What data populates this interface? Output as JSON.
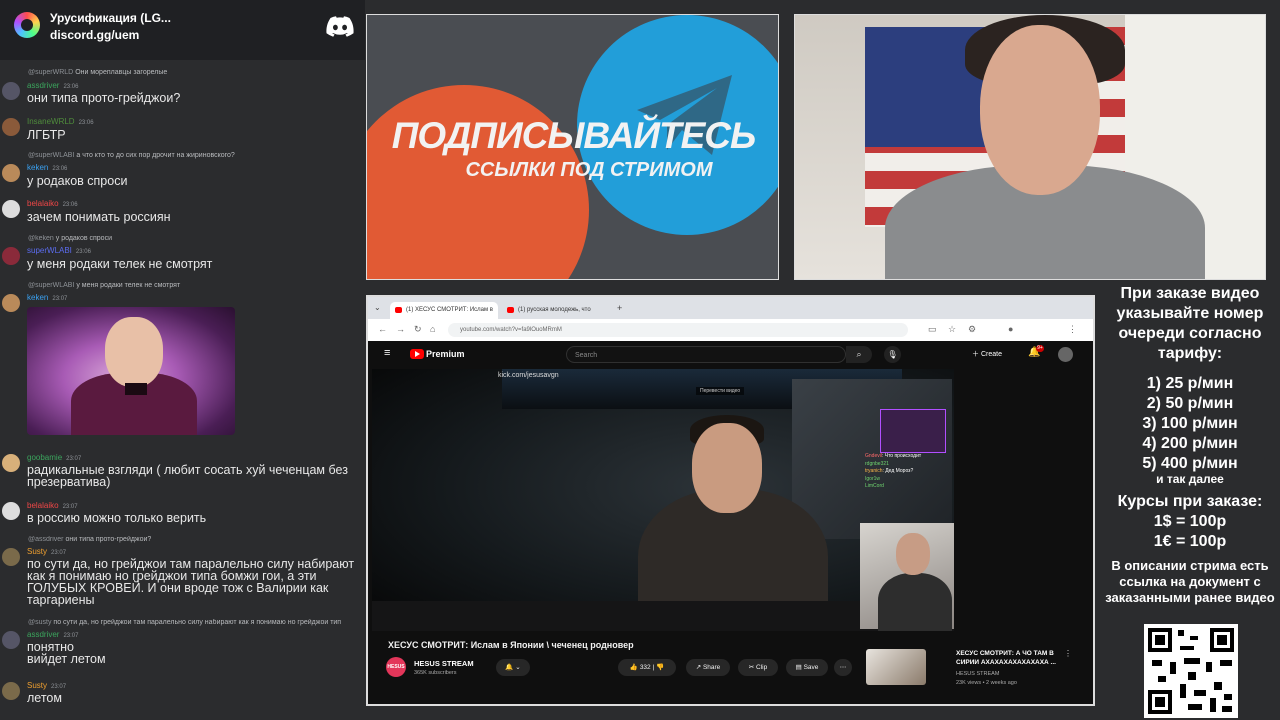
{
  "discord": {
    "server_name": "Урусификация (LG...",
    "invite": "discord.gg/uem"
  },
  "chat": [
    {
      "reply_to": "@superWRLD",
      "reply_text": "Они мореплавцы загорелые",
      "user": "assdriver",
      "time": "23:06",
      "text": "они типа прото-грейджои?",
      "color": "#3ba55d"
    },
    {
      "user": "InsaneWRLD",
      "time": "23:06",
      "text": "ЛГБТР",
      "color": "#4f8d3c"
    },
    {
      "reply_to": "@superWLABI",
      "reply_text": "а что кто то до сих пор дрочит на жириновского?",
      "user": "keken",
      "time": "23:06",
      "text": "у родаков спроси",
      "color": "#3aa0f0"
    },
    {
      "user": "belalaiko",
      "time": "23:06",
      "text": "зачем понимать россиян",
      "color": "#f04747"
    },
    {
      "reply_to": "@keken",
      "reply_text": "у родаков спроси",
      "user": "superWLABI",
      "time": "23:06",
      "text": "у меня родаки телек не смотрят",
      "color": "#5b6cf0"
    },
    {
      "reply_to": "@superWLABI",
      "reply_text": "у меня родаки телек не смотрят",
      "user": "keken",
      "time": "23:07",
      "text": "",
      "color": "#3aa0f0"
    },
    {
      "user": "goobamie",
      "time": "23:07",
      "text": "радикальные взгляди ( любит сосать хуй чеченцам без презерватива)",
      "color": "#3ba55d"
    },
    {
      "user": "belalaiko",
      "time": "23:07",
      "text": "в россию можно только верить",
      "color": "#f04747"
    },
    {
      "reply_to": "@assdriver",
      "reply_text": "они типа прото-грейджои?",
      "user": "Susty",
      "time": "23:07",
      "text": "по сути да, но грейджои там паралельно силу набирают как я понимаю но грейджои типа бомжи гои, а эти ГОЛУБЫХ КРОВЕЙ. И они вроде тож с Валирии как таргариены",
      "color": "#f0a030"
    },
    {
      "reply_to": "@susty",
      "reply_text": "по сути да, но грейджои там паралельно силу набирают как я понимаю но грейджои тип",
      "user": "assdriver",
      "time": "23:07",
      "text": "понятно вийдет летом",
      "color": "#3ba55d"
    },
    {
      "user": "Susty",
      "time": "23:07",
      "text": "летом",
      "color": "#f0a030"
    }
  ],
  "promo": {
    "line1": "ПОДПИСЫВАЙТЕСЬ",
    "line2": "ССЫЛКИ ПОД СТРИМОМ"
  },
  "browser": {
    "tab1": "(1) ХЕСУС СМОТРИТ: Ислам в",
    "tab2": "(1) русская молодежь, что",
    "url": "youtube.com/watch?v=fa9lOuoMRmM",
    "yt_brand": "Premium",
    "search_placeholder": "Search",
    "create_label": "Create",
    "notif_count": "9+",
    "video_overlay": "kick.com/jesusavgn",
    "video_badge": "Перевести видео",
    "mini_chat": [
      {
        "user": "Gndevil",
        "text": "Что происходит"
      },
      {
        "user": "rdgnbe321",
        "text": ""
      },
      {
        "user": "tryanich",
        "text": "Дед Мороз?"
      },
      {
        "user": "Igor1w",
        "text": ""
      },
      {
        "user": "LimCord",
        "text": ""
      }
    ],
    "video_title": "ХЕСУС СМОТРИТ: Ислам в Японии \\ чеченец родновер",
    "channel_avatar_text": "HESUS",
    "channel_name": "HESUS STREAM",
    "subscribers": "365K subscribers",
    "likes": "332",
    "share_label": "Share",
    "clip_label": "Clip",
    "save_label": "Save",
    "rec_title": "ХЕСУС СМОТРИТ: А ЧО ТАМ В СИРИИ АХАХАХАХАХАХАХА ...",
    "rec_channel": "HESUS STREAM",
    "rec_meta": "23K views • 2 weeks ago"
  },
  "info": {
    "intro": "При заказе видео указывайте номер очереди согласно тарифу:",
    "tariffs": [
      "1) 25 р/мин",
      "2) 50 р/мин",
      "3) 100 р/мин",
      "4) 200 р/мин",
      "5) 400 р/мин"
    ],
    "etc": "и так далее",
    "rates_title": "Курсы при заказе:",
    "rates": [
      "1$ = 100р",
      "1€ = 100р"
    ],
    "description": "В описании стрима есть ссылка на документ с заказанными ранее видео"
  }
}
